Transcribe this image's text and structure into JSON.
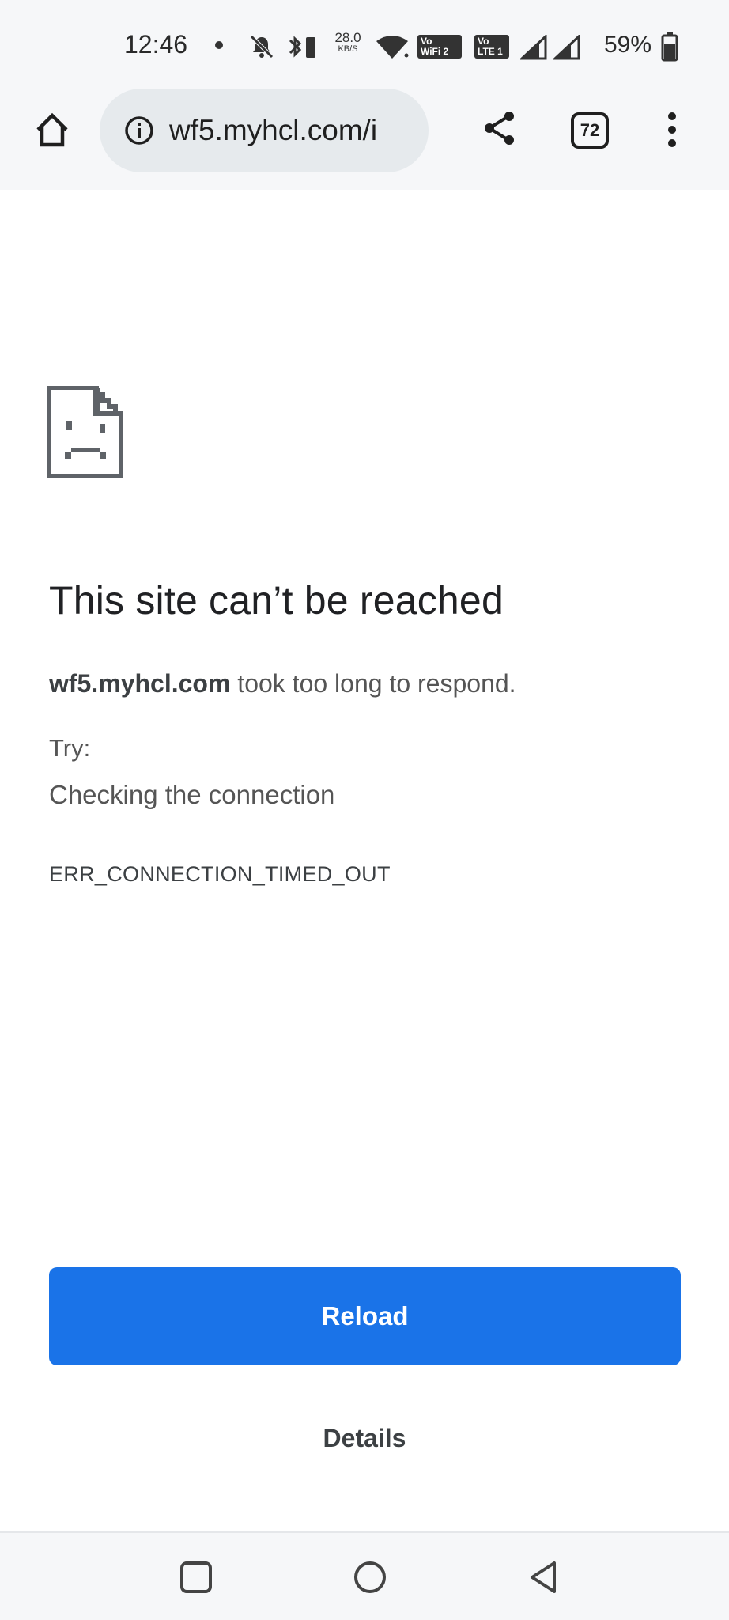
{
  "status_bar": {
    "time": "12:46",
    "speed_value": "28.0",
    "speed_unit": "KB/S",
    "wifi_tag_top": "Vo",
    "wifi_tag_bottom": "WiFi 2",
    "lte_tag_top": "Vo",
    "lte_tag_bottom": "LTE 1",
    "battery_percent": "59%",
    "icons": [
      "mute-icon",
      "bluetooth-icon",
      "wifi-icon",
      "signal-icon",
      "signal-icon",
      "battery-icon"
    ]
  },
  "toolbar": {
    "url": "wf5.myhcl.com/i",
    "tab_count": "72",
    "icons": [
      "home-icon",
      "info-icon",
      "share-icon",
      "tabs-icon",
      "more-vert-icon"
    ]
  },
  "error_page": {
    "icon": "sad-document-icon",
    "title": "This site can’t be reached",
    "host": "wf5.myhcl.com",
    "desc_suffix": " took too long to respond.",
    "try_label": "Try:",
    "suggestion": "Checking the connection",
    "error_code": "ERR_CONNECTION_TIMED_OUT",
    "reload_label": "Reload",
    "details_label": "Details"
  },
  "nav_bar": {
    "icons": [
      "recents-icon",
      "home-circle-icon",
      "back-triangle-icon"
    ]
  },
  "colors": {
    "accent": "#1a73e8",
    "chrome_bg": "#f6f7f9",
    "omnibox_bg": "#e6eaed"
  }
}
